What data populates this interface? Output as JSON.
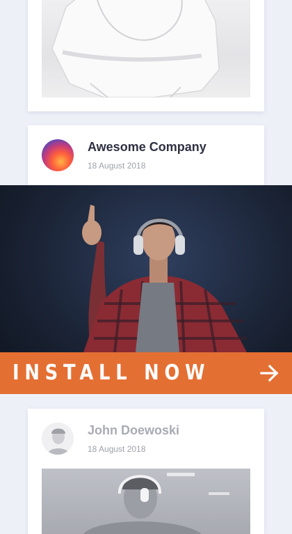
{
  "posts": [
    {
      "id": "top"
    },
    {
      "author": "Awesome Company",
      "date": "18 August 2018"
    },
    {
      "author": "John Doewoski",
      "date": "18 August 2018"
    }
  ],
  "ad": {
    "cta_label": "INSTALL NOW",
    "cta_icon": "arrow-right-icon",
    "accent": "#e46f33"
  },
  "colors": {
    "background": "#eef0f8",
    "card": "#ffffff",
    "name_active": "#2d3142",
    "name_faded": "#a9abb4",
    "date": "#9ea1ab"
  }
}
